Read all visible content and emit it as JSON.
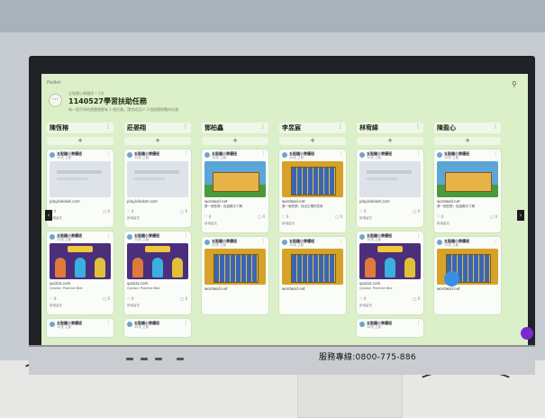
{
  "app": {
    "logo": "Padlet",
    "breadcrumb": "五股國小資優班 • 1分",
    "title": "1140527學習扶助任務",
    "description": "每一個不同的遊戲裡都有 1 個任務，請完成至少 3 個遊戲挑戰的任務",
    "brand_text": "服務專線:0800-775-886"
  },
  "columns": [
    {
      "title": "陳恆榕",
      "cards": [
        {
          "author": "五股國小資優班",
          "time": "10天 之前",
          "thumb": "gray",
          "url": "play.blooket.com",
          "likes": "0",
          "comments": "0",
          "comment_label": "新增留言"
        },
        {
          "author": "五股國小資優班",
          "time": "10天 之前",
          "thumb": "quiz",
          "url": "quizizz.com",
          "subtitle": "Quizizz: Practice Bee",
          "likes": "0",
          "comments": "0",
          "comment_label": "新增留言"
        },
        {
          "author": "五股國小資優班",
          "time": "10天 之前"
        }
      ]
    },
    {
      "title": "莊晏翔",
      "cards": [
        {
          "author": "五股國小資優班",
          "time": "10天 之前",
          "thumb": "gray",
          "url": "play.blooket.com",
          "likes": "0",
          "comments": "0",
          "comment_label": "新增留言"
        },
        {
          "author": "五股國小資優班",
          "time": "10天 之前",
          "thumb": "quiz",
          "url": "quizizz.com",
          "subtitle": "Quizizz: Practice Bee",
          "likes": "0",
          "comments": "0",
          "comment_label": "新增留言"
        },
        {
          "author": "五股國小資優班",
          "time": "10天 之前"
        }
      ]
    },
    {
      "title": "鄧柏鑫",
      "cards": [
        {
          "author": "五股國小資優班",
          "time": "10天 之前",
          "thumb": "game",
          "url": "wordwall.net",
          "subtitle": "第一個任務：從遊戲中了解",
          "likes": "0",
          "comments": "0",
          "comment_label": "新增留言"
        },
        {
          "author": "五股國小資優班",
          "time": "10天 之前",
          "thumb": "wordwall",
          "url": "wordwall.net"
        }
      ]
    },
    {
      "title": "李昱宸",
      "cards": [
        {
          "author": "五股國小資優班",
          "time": "10天 之前",
          "thumb": "wordwall",
          "url": "wordwall.net",
          "subtitle": "第一個任務：找出正確的答案",
          "likes": "0",
          "comments": "0",
          "comment_label": "新增留言"
        },
        {
          "author": "五股國小資優班",
          "time": "10天 之前",
          "thumb": "wordwall",
          "url": "wordwall.net"
        }
      ]
    },
    {
      "title": "林宥緯",
      "cards": [
        {
          "author": "五股國小資優班",
          "time": "10天 之前",
          "thumb": "gray",
          "url": "play.blooket.com",
          "likes": "0",
          "comments": "0",
          "comment_label": "新增留言"
        },
        {
          "author": "五股國小資優班",
          "time": "10天 之前",
          "thumb": "quiz",
          "url": "quizizz.com",
          "subtitle": "Quizizz: Practice Bee",
          "likes": "0",
          "comments": "0",
          "comment_label": "新增留言"
        },
        {
          "author": "五股國小資優班",
          "time": "10天 之前"
        }
      ]
    },
    {
      "title": "陳盈心",
      "cards": [
        {
          "author": "五股國小資優班",
          "time": "10天 之前",
          "thumb": "game",
          "url": "wordwall.net",
          "subtitle": "第一個任務：從遊戲中了解",
          "likes": "0",
          "comments": "0",
          "comment_label": "新增留言"
        },
        {
          "author": "五股國小資優班",
          "time": "10天 之前",
          "thumb": "wordwall",
          "url": "wordwall.net"
        }
      ]
    }
  ]
}
